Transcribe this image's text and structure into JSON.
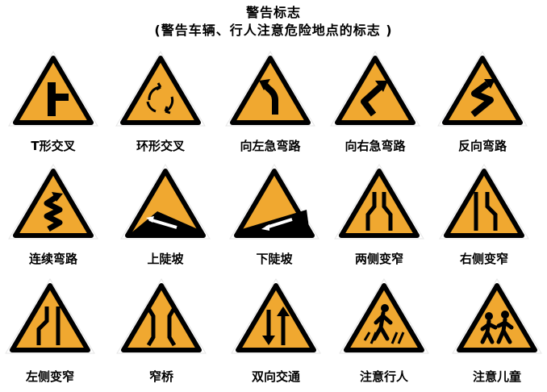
{
  "header": {
    "title": "警告标志",
    "subtitle": "(警告车辆、行人注意危险地点的标志 )"
  },
  "colors": {
    "sign_fill": "#f0a830",
    "sign_border": "#000000",
    "sign_outer": "#ffffff",
    "symbol": "#000000"
  },
  "signs": [
    {
      "label": "T形交叉",
      "icon": "t-junction-icon"
    },
    {
      "label": "环形交叉",
      "icon": "roundabout-icon"
    },
    {
      "label": "向左急弯路",
      "icon": "sharp-left-curve-icon"
    },
    {
      "label": "向右急弯路",
      "icon": "sharp-right-curve-icon"
    },
    {
      "label": "反向弯路",
      "icon": "reverse-curve-icon"
    },
    {
      "label": "连续弯路",
      "icon": "winding-road-icon"
    },
    {
      "label": "上陡坡",
      "icon": "steep-ascent-icon"
    },
    {
      "label": "下陡坡",
      "icon": "steep-descent-icon"
    },
    {
      "label": "两侧变窄",
      "icon": "road-narrows-both-icon"
    },
    {
      "label": "右侧变窄",
      "icon": "road-narrows-right-icon"
    },
    {
      "label": "左侧变窄",
      "icon": "road-narrows-left-icon"
    },
    {
      "label": "窄桥",
      "icon": "narrow-bridge-icon"
    },
    {
      "label": "双向交通",
      "icon": "two-way-traffic-icon"
    },
    {
      "label": "注意行人",
      "icon": "pedestrian-crossing-icon"
    },
    {
      "label": "注意儿童",
      "icon": "children-crossing-icon"
    }
  ]
}
